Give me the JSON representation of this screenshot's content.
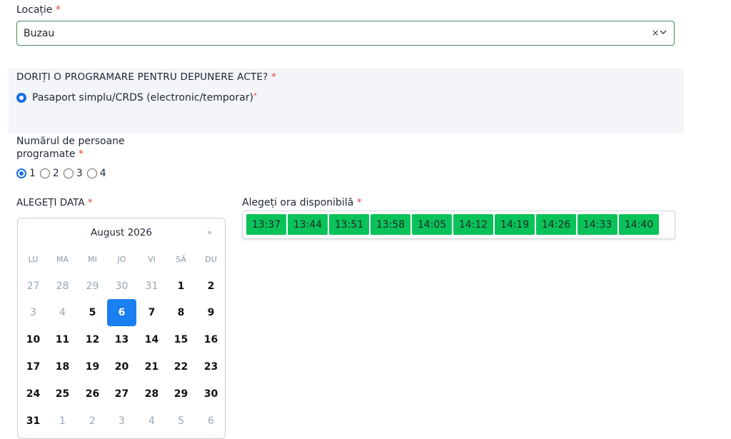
{
  "location": {
    "label": "Locație",
    "required_mark": "*",
    "value": "Buzau",
    "clear_glyph": "×",
    "chevron_glyph": "⌄"
  },
  "appointment_type": {
    "question": "DORIȚI O PROGRAMARE PENTRU DEPUNERE ACTE?",
    "required_mark": "*",
    "option_label": "Pasaport simplu/CRDS (electronic/temporar)",
    "option_mark": "*"
  },
  "persons": {
    "label_line1": "Numărul de persoane",
    "label_line2": "programate",
    "required_mark": "*",
    "options": [
      "1",
      "2",
      "3",
      "4"
    ],
    "selected": "1"
  },
  "date": {
    "label": "ALEGEȚI DATA",
    "required_mark": "*",
    "month_title": "August 2026",
    "next_glyph": "»",
    "weekdays": [
      "LU",
      "MA",
      "MI",
      "JO",
      "VI",
      "SĂ",
      "DU"
    ],
    "weeks": [
      [
        "27",
        "28",
        "29",
        "30",
        "31",
        "1",
        "2"
      ],
      [
        "3",
        "4",
        "5",
        "6",
        "7",
        "8",
        "9"
      ],
      [
        "10",
        "11",
        "12",
        "13",
        "14",
        "15",
        "16"
      ],
      [
        "17",
        "18",
        "19",
        "20",
        "21",
        "22",
        "23"
      ],
      [
        "24",
        "25",
        "26",
        "27",
        "28",
        "29",
        "30"
      ],
      [
        "31",
        "1",
        "2",
        "3",
        "4",
        "5",
        "6"
      ]
    ],
    "selected_day": "6"
  },
  "time": {
    "label": "Alegeți ora disponibilă",
    "required_mark": "*",
    "slots": [
      "13:37",
      "13:44",
      "13:51",
      "13:58",
      "14:05",
      "14:12",
      "14:19",
      "14:26",
      "14:33",
      "14:40"
    ],
    "slot_color": "#0ac25a"
  },
  "colors": {
    "accent": "#1a7ff0",
    "required": "#e0463f",
    "panel_bg": "#f3f5f8",
    "select_border": "#4a8a5e"
  }
}
